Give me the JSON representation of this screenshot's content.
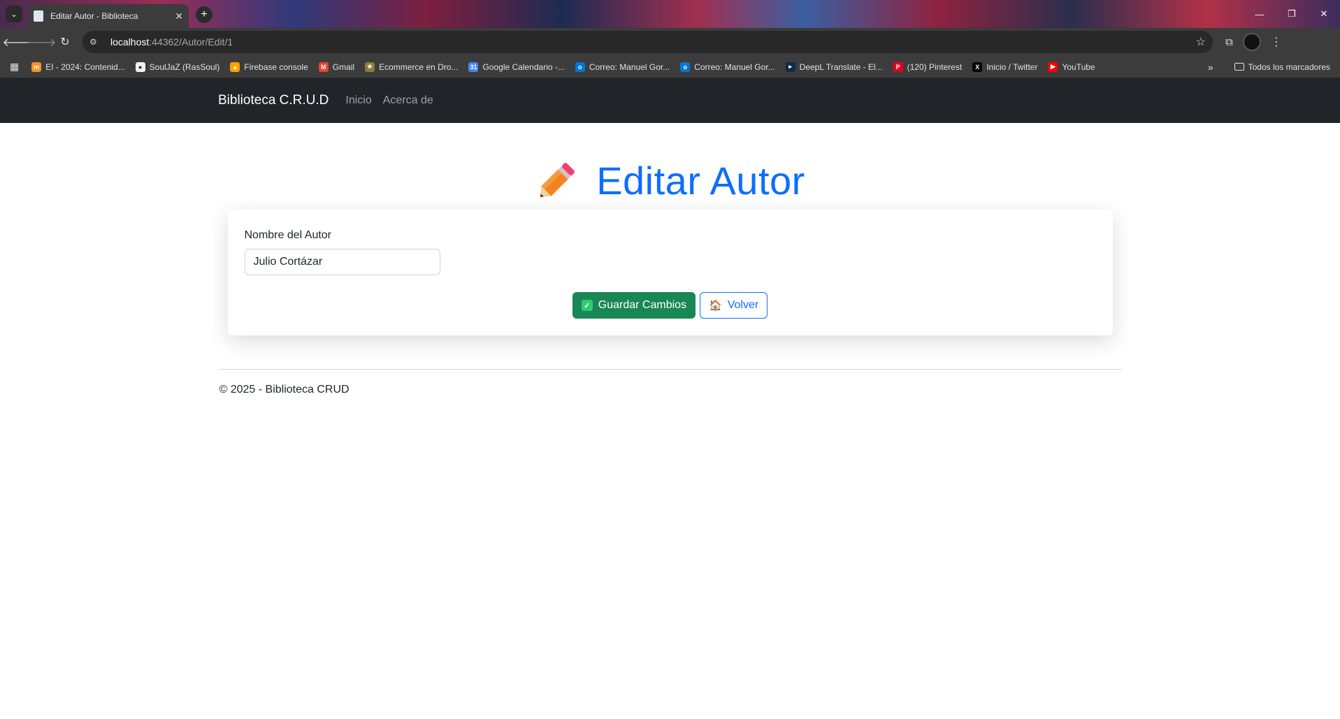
{
  "browser": {
    "tab": {
      "title": "Editar Autor - Biblioteca",
      "close": "✕"
    },
    "new_tab": "+",
    "window_controls": {
      "minimize": "—",
      "maximize": "❐",
      "close": "✕"
    },
    "url": {
      "host": "localhost",
      "path": ":44362/Autor/Edit/1"
    },
    "bookmarks": [
      {
        "label": "EI - 2024: Contenid...",
        "icon": "moodle-icon",
        "color": "#f7931e",
        "glyph": "m"
      },
      {
        "label": "SoulJaZ (RasSoul)",
        "icon": "github-icon",
        "color": "#f0f0f0",
        "glyph": "●"
      },
      {
        "label": "Firebase console",
        "icon": "firebase-icon",
        "color": "#ffa000",
        "glyph": "▲"
      },
      {
        "label": "Gmail",
        "icon": "gmail-icon",
        "color": "#ea4335",
        "glyph": "M"
      },
      {
        "label": "Ecommerce en Dro...",
        "icon": "star-icon",
        "color": "#8c7b3a",
        "glyph": "★"
      },
      {
        "label": "Google Calendario -...",
        "icon": "calendar-icon",
        "color": "#4285f4",
        "glyph": "31"
      },
      {
        "label": "Correo: Manuel Gor...",
        "icon": "outlook-icon",
        "color": "#0078d4",
        "glyph": "o"
      },
      {
        "label": "Correo: Manuel Gor...",
        "icon": "outlook-icon",
        "color": "#0078d4",
        "glyph": "o"
      },
      {
        "label": "DeepL Translate - El...",
        "icon": "deepl-icon",
        "color": "#0f2b46",
        "glyph": "▸"
      },
      {
        "label": "(120) Pinterest",
        "icon": "pinterest-icon",
        "color": "#e60023",
        "glyph": "P"
      },
      {
        "label": "Inicio / Twitter",
        "icon": "x-icon",
        "color": "#000000",
        "glyph": "X"
      },
      {
        "label": "YouTube",
        "icon": "youtube-icon",
        "color": "#ff0000",
        "glyph": "▶"
      }
    ],
    "bookmarks_more": "»",
    "bookmarks_folder": "Todos los marcadores"
  },
  "navbar": {
    "brand": "Biblioteca C.R.U.D",
    "links": [
      "Inicio",
      "Acerca de"
    ]
  },
  "page": {
    "heading": "Editar Autor",
    "form": {
      "label": "Nombre del Autor",
      "value": "Julio Cortázar"
    },
    "buttons": {
      "save": "Guardar Cambios",
      "back": "Volver"
    }
  },
  "footer": {
    "text": "© 2025 - Biblioteca CRUD"
  },
  "colors": {
    "primary": "#0d6efd",
    "success": "#198754",
    "navbar": "#212529"
  }
}
